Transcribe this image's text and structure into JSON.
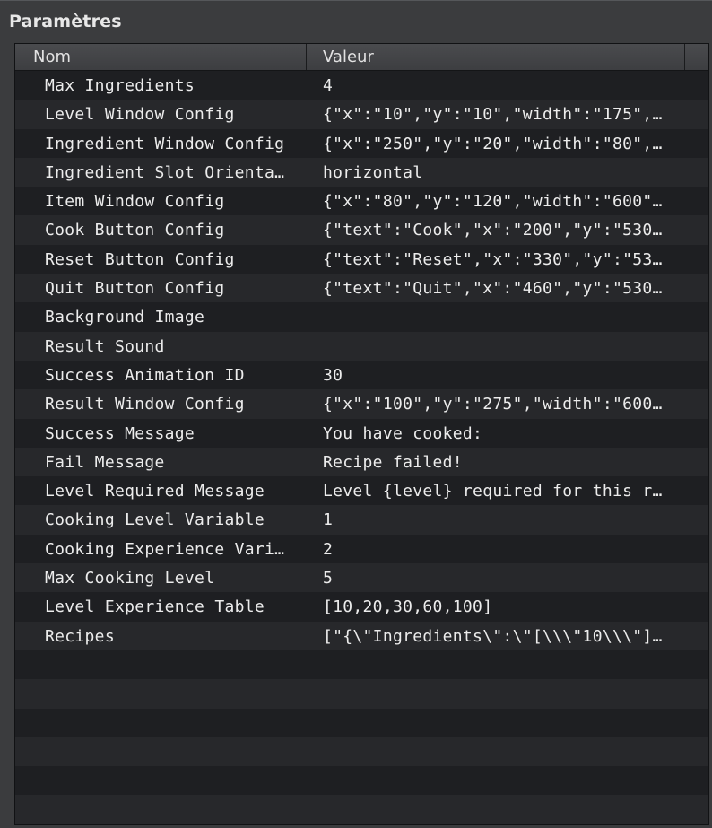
{
  "panel": {
    "title": "Paramètres"
  },
  "columns": {
    "name": "Nom",
    "value": "Valeur"
  },
  "rows": [
    {
      "name": "Max Ingredients",
      "value": "4"
    },
    {
      "name": "Level Window Config",
      "value": "{\"x\":\"10\",\"y\":\"10\",\"width\":\"175\",…"
    },
    {
      "name": "Ingredient Window Config",
      "value": "{\"x\":\"250\",\"y\":\"20\",\"width\":\"80\",…"
    },
    {
      "name": "Ingredient Slot Orienta…",
      "value": "horizontal"
    },
    {
      "name": "Item Window Config",
      "value": "{\"x\":\"80\",\"y\":\"120\",\"width\":\"600\"…"
    },
    {
      "name": "Cook Button Config",
      "value": "{\"text\":\"Cook\",\"x\":\"200\",\"y\":\"530…"
    },
    {
      "name": "Reset Button Config",
      "value": "{\"text\":\"Reset\",\"x\":\"330\",\"y\":\"53…"
    },
    {
      "name": "Quit Button Config",
      "value": "{\"text\":\"Quit\",\"x\":\"460\",\"y\":\"530…"
    },
    {
      "name": "Background Image",
      "value": ""
    },
    {
      "name": "Result Sound",
      "value": ""
    },
    {
      "name": "Success Animation ID",
      "value": "30"
    },
    {
      "name": "Result Window Config",
      "value": "{\"x\":\"100\",\"y\":\"275\",\"width\":\"600…"
    },
    {
      "name": "Success Message",
      "value": "You have cooked:"
    },
    {
      "name": "Fail Message",
      "value": "Recipe failed!"
    },
    {
      "name": "Level Required Message",
      "value": "Level {level} required for this r…"
    },
    {
      "name": "Cooking Level Variable",
      "value": "1"
    },
    {
      "name": "Cooking Experience Vari…",
      "value": "2"
    },
    {
      "name": "Max Cooking Level",
      "value": "5"
    },
    {
      "name": "Level Experience Table",
      "value": "[10,20,30,60,100]"
    },
    {
      "name": "Recipes",
      "value": "[\"{\\\"Ingredients\\\":\\\"[\\\\\\\"10\\\\\\\"]…"
    }
  ]
}
